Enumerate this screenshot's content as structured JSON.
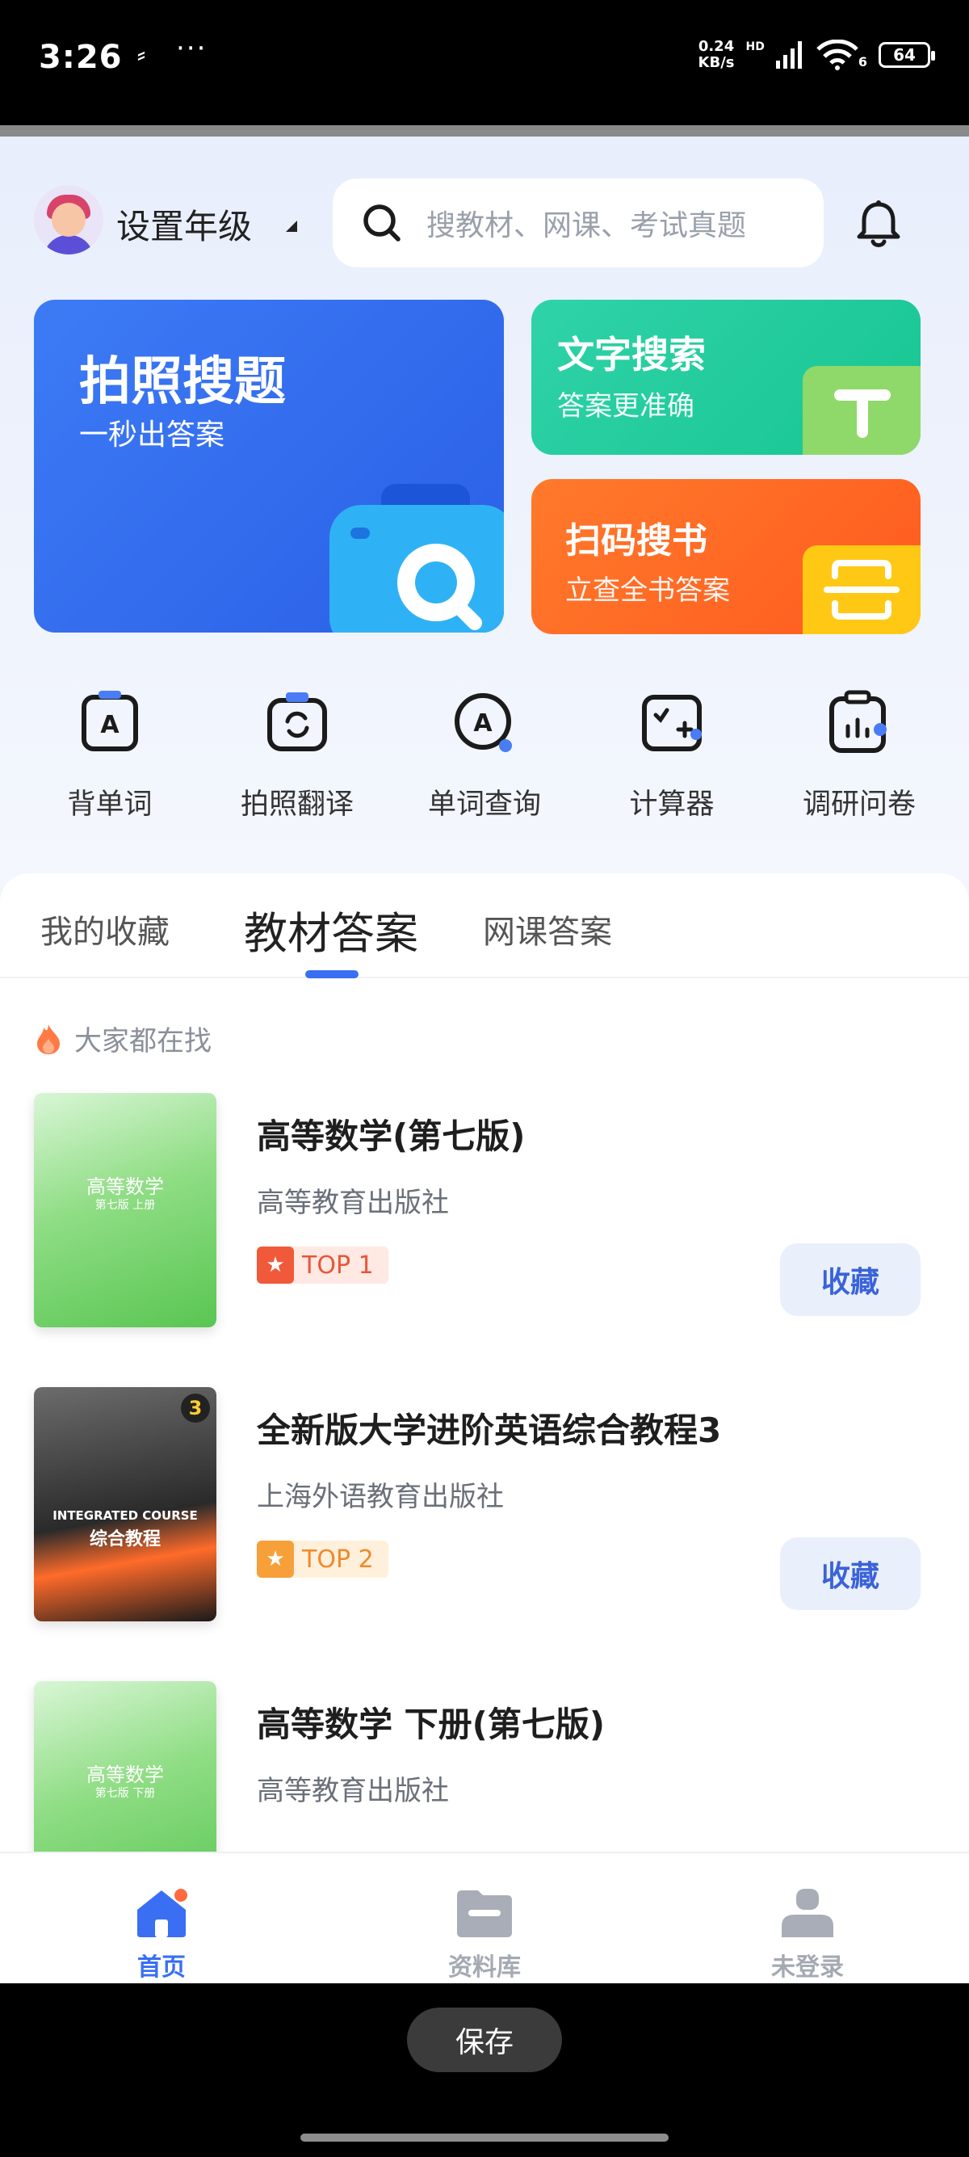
{
  "status_bar": {
    "time": "3:26",
    "extra_glyph": "⸗",
    "dots": "···",
    "speed_value": "0.24",
    "speed_unit": "KB/s",
    "network_badge": "HD",
    "wifi_suffix": "6",
    "battery": "64"
  },
  "header": {
    "grade_label": "设置年级",
    "search_placeholder": "搜教材、网课、考试真题"
  },
  "features": {
    "photo": {
      "title": "拍照搜题",
      "subtitle": "一秒出答案"
    },
    "text": {
      "title": "文字搜索",
      "subtitle": "答案更准确"
    },
    "scan": {
      "title": "扫码搜书",
      "subtitle": "立查全书答案"
    }
  },
  "tools": [
    {
      "label": "背单词",
      "icon": "vocabulary-icon"
    },
    {
      "label": "拍照翻译",
      "icon": "photo-translate-icon"
    },
    {
      "label": "单词查询",
      "icon": "word-lookup-icon"
    },
    {
      "label": "计算器",
      "icon": "calculator-icon"
    },
    {
      "label": "调研问卷",
      "icon": "survey-icon"
    }
  ],
  "tabs": [
    {
      "label": "我的收藏"
    },
    {
      "label": "教材答案"
    },
    {
      "label": "网课答案"
    }
  ],
  "hot_label": "大家都在找",
  "books": [
    {
      "title": "高等数学(第七版)",
      "publisher": "高等教育出版社",
      "rank": "TOP 1",
      "action": "收藏",
      "cover_title": "高等数学",
      "cover_sub": "第七版 上册"
    },
    {
      "title": "全新版大学进阶英语综合教程3",
      "publisher": "上海外语教育出版社",
      "rank": "TOP 2",
      "action": "收藏",
      "cover_title": "综合教程",
      "cover_sub": "INTEGRATED COURSE",
      "cover_num": "3"
    },
    {
      "title": "高等数学 下册(第七版)",
      "publisher": "高等教育出版社",
      "cover_title": "高等数学",
      "cover_sub": "第七版 下册"
    }
  ],
  "nav": [
    {
      "label": "首页",
      "icon": "home-icon"
    },
    {
      "label": "资料库",
      "icon": "folder-icon"
    },
    {
      "label": "未登录",
      "icon": "user-icon"
    }
  ],
  "footer": {
    "save_label": "保存"
  },
  "colors": {
    "primary": "#3a6ff3",
    "photo_card": "#2f6bf0",
    "text_card": "#22cc9c",
    "scan_card": "#ff6a24"
  }
}
